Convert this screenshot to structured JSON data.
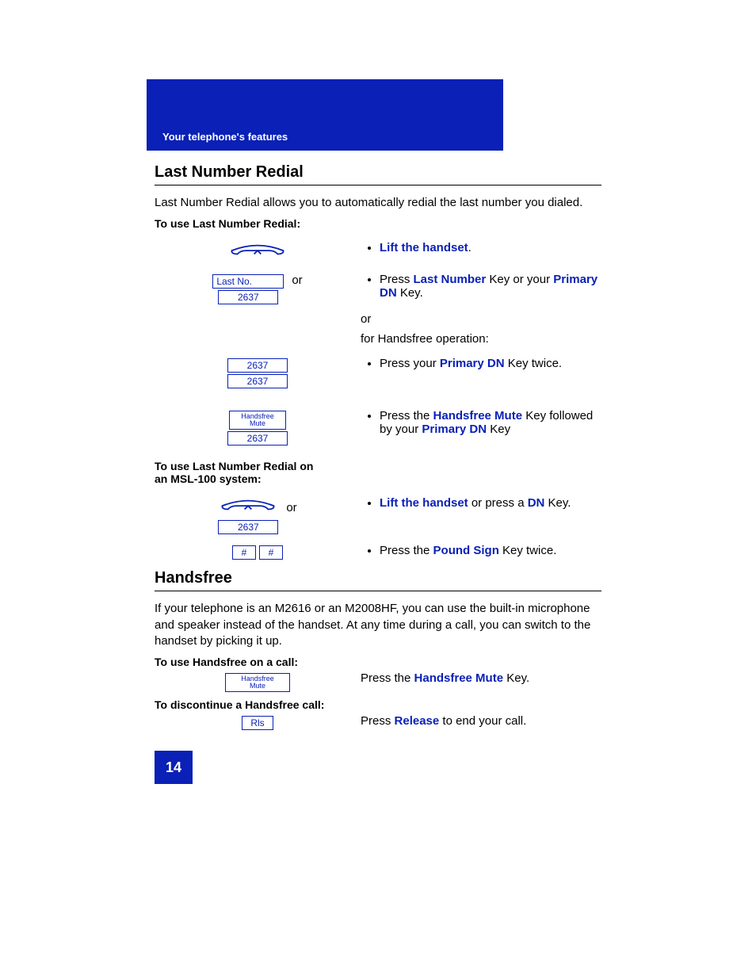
{
  "header": "Your telephone's features",
  "page_number": "14",
  "section1": {
    "title": "Last Number Redial",
    "intro": "Last Number Redial allows you to automatically redial the last number you dialed.",
    "procedure_a_label": "To use Last Number Redial:",
    "procedure_b_label": "To use Last Number Redial on an MSL-100 system:",
    "keys": {
      "last_no": "Last No.",
      "dn": "2637",
      "handsfree": "Handsfree Mute",
      "pound": "#"
    },
    "or": "or",
    "steps_a": {
      "s1": {
        "lift": "Lift the handset",
        "tail": "."
      },
      "s2": {
        "pre": "Press ",
        "k1": "Last Number",
        "mid": " Key or your ",
        "k2": "Primary DN",
        "tail": " Key."
      },
      "or_line": "or",
      "hf_line": "for Handsfree operation:",
      "s3": {
        "pre": "Press your ",
        "k1": "Primary DN",
        "tail": " Key twice."
      },
      "s4": {
        "pre": "Press the ",
        "k1": "Handsfree Mute",
        "mid": " Key followed by your ",
        "k2": "Primary DN",
        "tail": " Key"
      }
    },
    "steps_b": {
      "s1": {
        "lift": "Lift the handset",
        "mid": " or press a ",
        "k1": "DN",
        "tail": " Key."
      },
      "s2": {
        "pre": "Press the ",
        "k1": "Pound Sign",
        "tail": " Key twice."
      }
    }
  },
  "section2": {
    "title": "Handsfree",
    "intro": "If your telephone is an M2616 or an M2008HF, you can use the built-in microphone and speaker instead of the handset. At any time during a call, you can switch to the handset by picking it up.",
    "procedure_a_label": "To use Handsfree on a call:",
    "procedure_b_label": "To discontinue a Handsfree call:",
    "keys": {
      "handsfree": "Handsfree Mute",
      "rls": "Rls"
    },
    "step_a": {
      "pre": "Press the ",
      "k1": "Handsfree Mute",
      "tail": " Key."
    },
    "step_b": {
      "pre": "Press ",
      "k1": "Release",
      "tail": " to end your call."
    }
  }
}
